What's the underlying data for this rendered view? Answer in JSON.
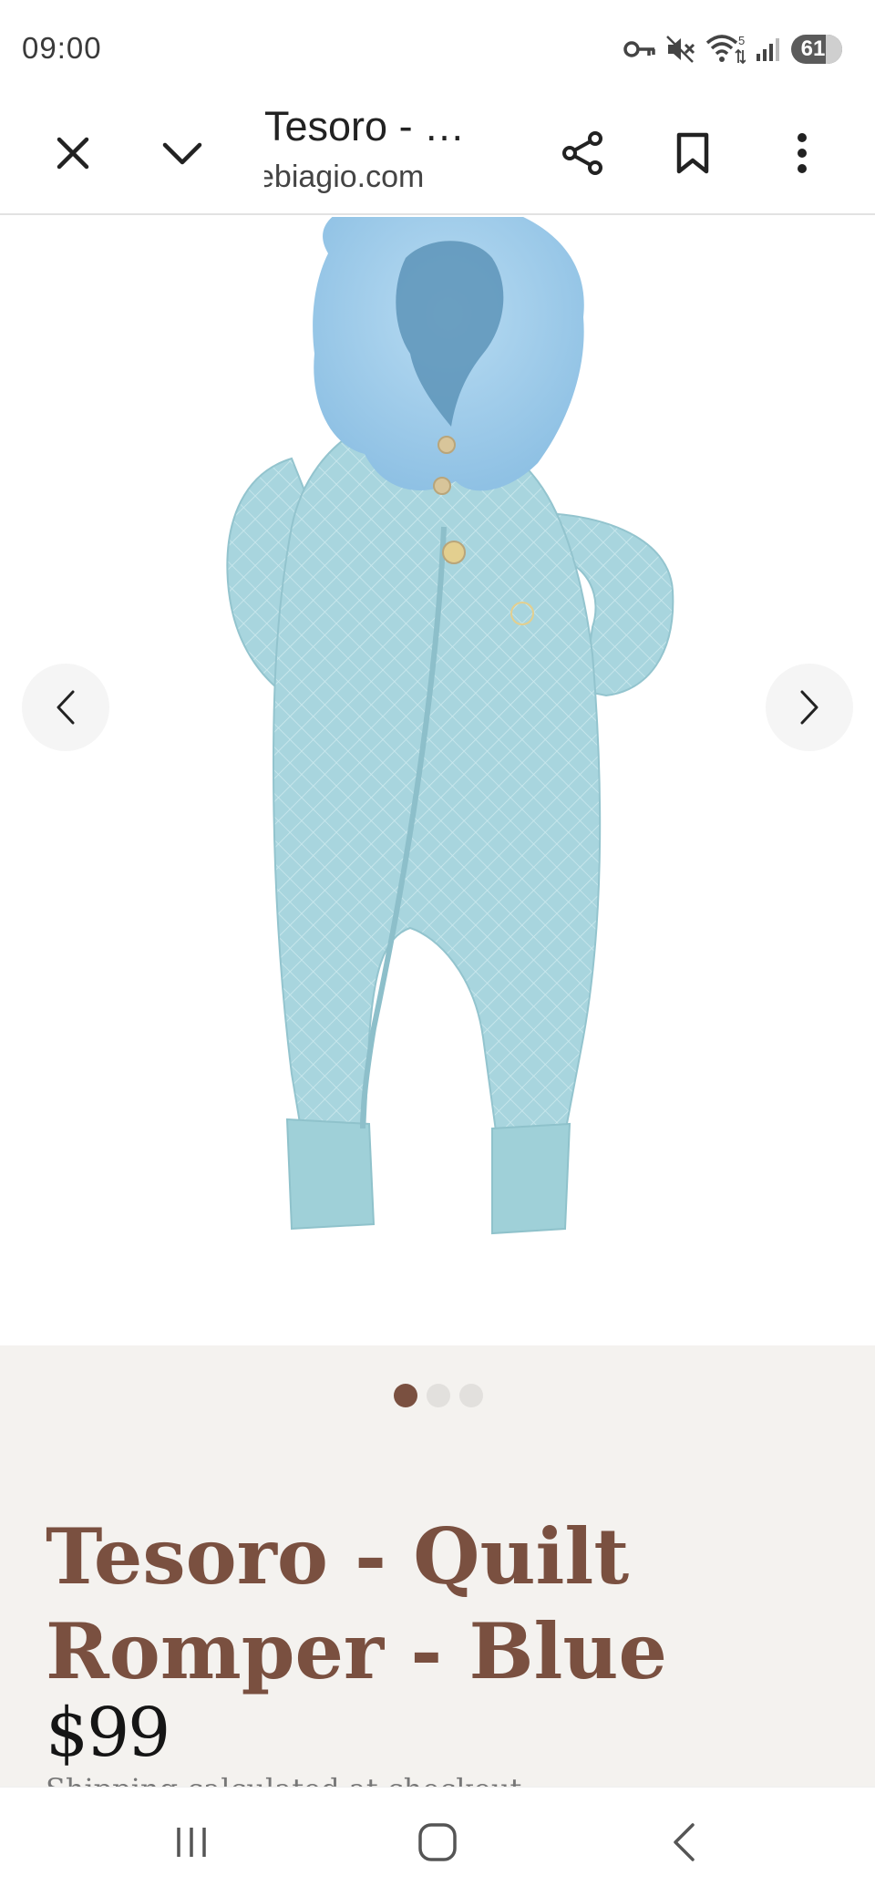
{
  "status_bar": {
    "time": "09:00",
    "battery_level": "61",
    "wifi_badge": "5",
    "icons": [
      "vpn-key-icon",
      "mute-icon",
      "wifi-icon",
      "signal-icon",
      "battery-icon"
    ]
  },
  "browser": {
    "tab_title": "Tesoro - …",
    "url": "ebiagio.com",
    "icons": [
      "close-icon",
      "chevron-down-icon",
      "share-icon",
      "bookmark-icon",
      "more-vert-icon"
    ]
  },
  "gallery": {
    "image_subject": "light blue quilted baby romper with faux fur hood",
    "slide_count": 3,
    "active_slide": 1,
    "colors": {
      "romper": "#a9d6de",
      "fur": "#9cc8e6"
    }
  },
  "product": {
    "title": "Tesoro - Quilt Romper - Blue",
    "price": "$99",
    "shipping_note": "Shipping calculated at checkout."
  },
  "system_nav": {
    "icons": [
      "recents-icon",
      "home-icon",
      "back-icon"
    ]
  },
  "theme": {
    "accent": "#7a5040",
    "info_bg": "#f4f2ef"
  }
}
